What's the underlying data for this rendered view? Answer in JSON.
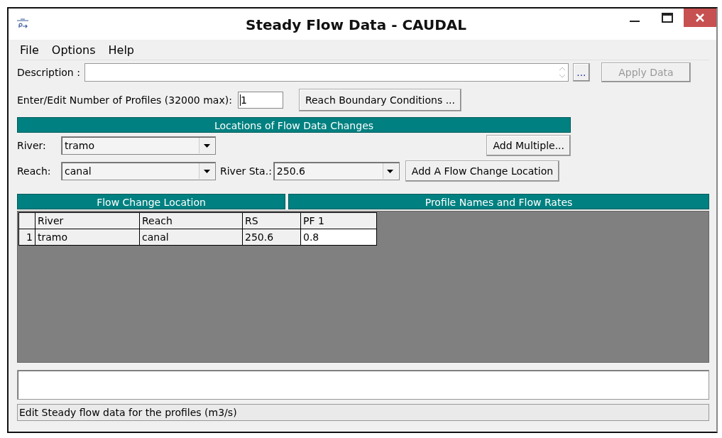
{
  "window": {
    "title": "Steady Flow Data - CAUDAL"
  },
  "menu": [
    "File",
    "Options",
    "Help"
  ],
  "description": {
    "label": "Description :",
    "browse_label": "..."
  },
  "apply_button": {
    "label": "Apply Data",
    "disabled": true
  },
  "profiles": {
    "label": "Enter/Edit Number of Profiles (32000 max):",
    "value": "1"
  },
  "boundary_button": {
    "label": "Reach Boundary Conditions ..."
  },
  "locations": {
    "title": "Locations of Flow Data Changes",
    "river": {
      "label": "River:",
      "value": "tramo"
    },
    "reach": {
      "label": "Reach:",
      "value": "canal"
    },
    "river_station": {
      "label": "River Sta.:",
      "value": "250.6"
    },
    "add_multiple": "Add Multiple...",
    "add_location": "Add A Flow Change Location"
  },
  "table": {
    "group_headers": [
      "Flow Change Location",
      "Profile Names and Flow Rates"
    ],
    "columns": [
      "River",
      "Reach",
      "RS",
      "PF 1"
    ],
    "rows": [
      {
        "number": "1",
        "cells": [
          "tramo",
          "canal",
          "250.6",
          "0.8"
        ]
      }
    ]
  },
  "status_bar": "Edit Steady flow data for the profiles (m3/s)"
}
